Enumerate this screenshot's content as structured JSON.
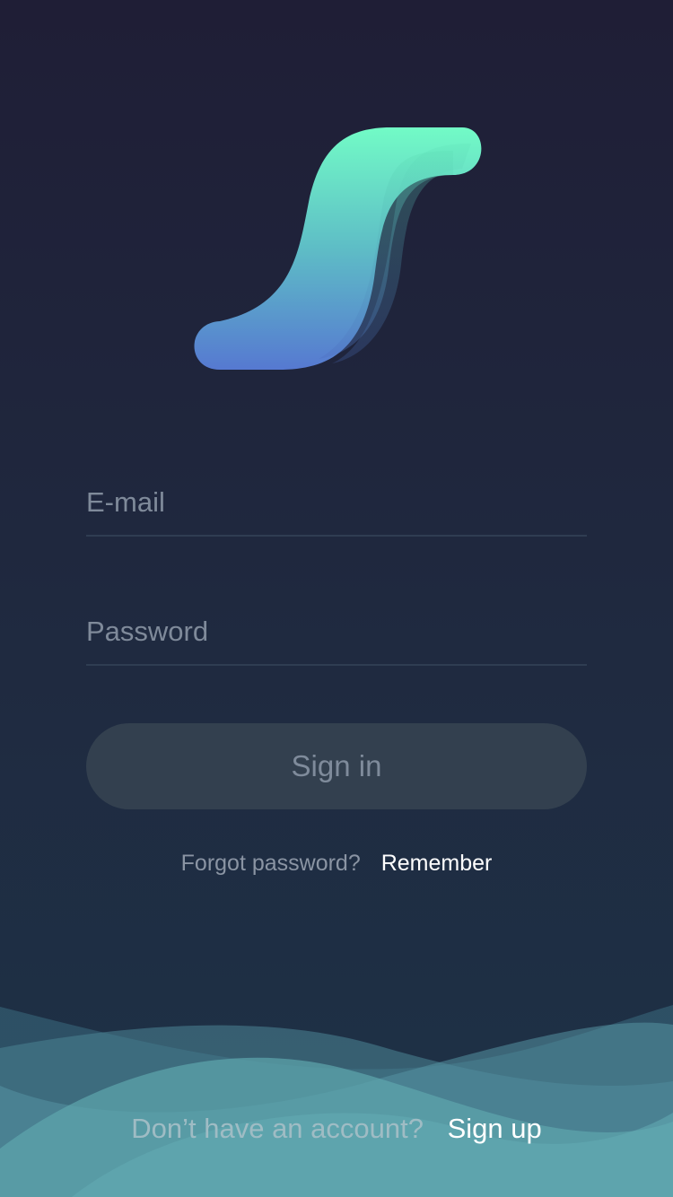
{
  "logo": {
    "icon": "swoosh-s-logo",
    "gradient_top": "#6ffcc8",
    "gradient_bottom": "#5478d2"
  },
  "form": {
    "email_placeholder": "E-mail",
    "email_value": "",
    "password_placeholder": "Password",
    "password_value": "",
    "signin_label": "Sign in"
  },
  "forgot": {
    "question": "Forgot password?",
    "link_label": "Remember"
  },
  "signup": {
    "question": "Don’t have an account?",
    "link_label": "Sign up"
  },
  "colors": {
    "background_top": "#1f1e36",
    "background_bottom": "#1e3247",
    "button_bg": "#33404f",
    "wave": "#5ea7ae"
  }
}
